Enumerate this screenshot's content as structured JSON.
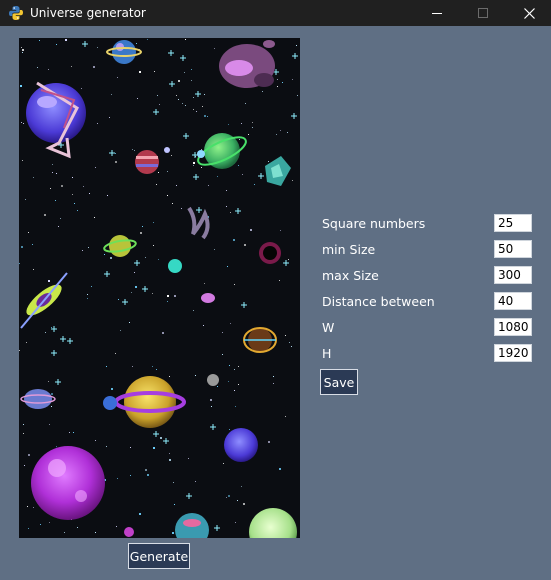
{
  "window": {
    "title": "Universe generator",
    "icon": "python-icon",
    "controls": [
      "minimize-icon",
      "maximize-icon",
      "close-icon"
    ]
  },
  "canvas": {
    "description_icon": "generated-universe-image",
    "background": "#0b0d12"
  },
  "settings": {
    "fields": [
      {
        "label": "Square numbers",
        "value": "25"
      },
      {
        "label": "min Size",
        "value": "50"
      },
      {
        "label": "max Size",
        "value": "300"
      },
      {
        "label": "Distance between",
        "value": "40"
      },
      {
        "label": "W",
        "value": "1080"
      },
      {
        "label": "H",
        "value": "1920"
      }
    ],
    "save_label": "Save"
  },
  "generate_label": "Generate",
  "colors": {
    "window_background": "#5f6f84",
    "titlebar": "#202020",
    "button_background": "#2b3a55"
  }
}
